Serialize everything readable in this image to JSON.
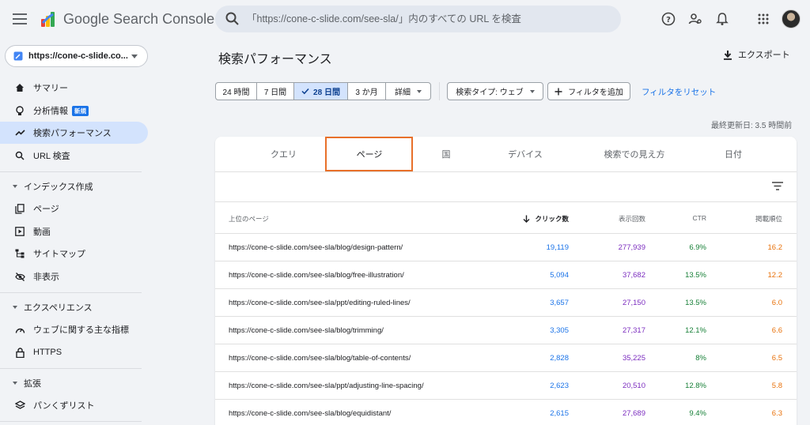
{
  "header": {
    "app_title": "Google Search Console",
    "search_placeholder": "「https://cone-c-slide.com/see-sla/」内のすべての URL を検査"
  },
  "property": {
    "name": "https://cone-c-slide.co..."
  },
  "sidebar": {
    "items": [
      {
        "label": "サマリー",
        "icon": "home-icon"
      },
      {
        "label": "分析情報",
        "icon": "lightbulb-icon",
        "badge": "新規"
      },
      {
        "label": "検索パフォーマンス",
        "icon": "trending-up-icon",
        "active": true
      },
      {
        "label": "URL 検査",
        "icon": "search-icon"
      }
    ],
    "sections": [
      {
        "label": "インデックス作成",
        "items": [
          {
            "label": "ページ",
            "icon": "pages-icon"
          },
          {
            "label": "動画",
            "icon": "video-icon"
          },
          {
            "label": "サイトマップ",
            "icon": "sitemap-icon"
          },
          {
            "label": "非表示",
            "icon": "visibility-off-icon"
          }
        ]
      },
      {
        "label": "エクスペリエンス",
        "items": [
          {
            "label": "ウェブに関する主な指標",
            "icon": "speed-icon"
          },
          {
            "label": "HTTPS",
            "icon": "lock-icon"
          }
        ]
      },
      {
        "label": "拡張",
        "items": [
          {
            "label": "パンくずリスト",
            "icon": "layers-icon"
          }
        ]
      }
    ]
  },
  "main": {
    "title": "検索パフォーマンス",
    "export_label": "エクスポート",
    "date_ranges": [
      "24 時間",
      "7 日間",
      "28 日間",
      "3 か月",
      "詳細"
    ],
    "selected_range": "28 日間",
    "search_type": "検索タイプ: ウェブ",
    "add_filter": "フィルタを追加",
    "reset_filters": "フィルタをリセット",
    "last_updated": "最終更新日: 3.5 時間前"
  },
  "tabs": [
    "クエリ",
    "ページ",
    "国",
    "デバイス",
    "検索での見え方",
    "日付"
  ],
  "selected_tab": "ページ",
  "table": {
    "headers": {
      "page": "上位のページ",
      "clicks": "クリック数",
      "impressions": "表示回数",
      "ctr": "CTR",
      "position": "掲載順位"
    },
    "rows": [
      {
        "url": "https://cone-c-slide.com/see-sla/blog/design-pattern/",
        "clicks": "19,119",
        "impressions": "277,939",
        "ctr": "6.9%",
        "position": "16.2"
      },
      {
        "url": "https://cone-c-slide.com/see-sla/blog/free-illustration/",
        "clicks": "5,094",
        "impressions": "37,682",
        "ctr": "13.5%",
        "position": "12.2"
      },
      {
        "url": "https://cone-c-slide.com/see-sla/ppt/editing-ruled-lines/",
        "clicks": "3,657",
        "impressions": "27,150",
        "ctr": "13.5%",
        "position": "6.0"
      },
      {
        "url": "https://cone-c-slide.com/see-sla/blog/trimming/",
        "clicks": "3,305",
        "impressions": "27,317",
        "ctr": "12.1%",
        "position": "6.6"
      },
      {
        "url": "https://cone-c-slide.com/see-sla/blog/table-of-contents/",
        "clicks": "2,828",
        "impressions": "35,225",
        "ctr": "8%",
        "position": "6.5"
      },
      {
        "url": "https://cone-c-slide.com/see-sla/ppt/adjusting-line-spacing/",
        "clicks": "2,623",
        "impressions": "20,510",
        "ctr": "12.8%",
        "position": "5.8"
      },
      {
        "url": "https://cone-c-slide.com/see-sla/blog/equidistant/",
        "clicks": "2,615",
        "impressions": "27,689",
        "ctr": "9.4%",
        "position": "6.3"
      }
    ]
  },
  "colors": {
    "accent": "#1a73e8",
    "clicks": "#1a73e8",
    "impressions": "#7b2cbf",
    "ctr": "#188038",
    "position": "#e8710a",
    "tab_highlight": "#e8702a"
  }
}
